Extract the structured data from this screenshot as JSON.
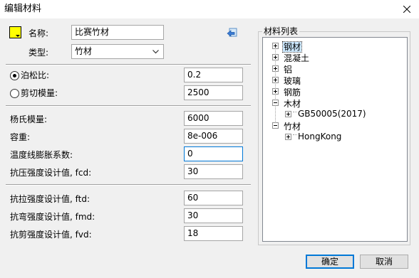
{
  "window": {
    "title": "编辑材料"
  },
  "colors": {
    "swatch": "#ffff00",
    "accent": "#0078d7"
  },
  "header": {
    "name_label": "名称:",
    "name_value": "比赛竹材",
    "type_label": "类型:",
    "type_value": "竹材"
  },
  "elastic": {
    "poisson_label": "泊松比:",
    "poisson_value": "0.2",
    "shear_label": "剪切模量:",
    "shear_value": "2500",
    "selected": "poisson"
  },
  "props": {
    "young_label": "杨氏模量:",
    "young_value": "6000",
    "density_label": "容重:",
    "density_value": "8e-006",
    "thermal_label": "温度线膨胀系数:",
    "thermal_value": "0",
    "fcd_label": "抗压强度设计值, fcd:",
    "fcd_value": "30"
  },
  "strength": {
    "ftd_label": "抗拉强度设计值, ftd:",
    "ftd_value": "60",
    "fmd_label": "抗弯强度设计值, fmd:",
    "fmd_value": "30",
    "fvd_label": "抗剪强度设计值, fvd:",
    "fvd_value": "18"
  },
  "material_list": {
    "title": "材料列表",
    "items": [
      {
        "label": "钢材",
        "state": "collapsed"
      },
      {
        "label": "混凝土",
        "state": "collapsed"
      },
      {
        "label": "铝",
        "state": "collapsed"
      },
      {
        "label": "玻璃",
        "state": "collapsed"
      },
      {
        "label": "钢筋",
        "state": "collapsed"
      },
      {
        "label": "木材",
        "state": "expanded",
        "children": [
          {
            "label": "GB50005(2017)",
            "state": "collapsed"
          }
        ]
      },
      {
        "label": "竹材",
        "state": "expanded",
        "children": [
          {
            "label": "HongKong",
            "state": "collapsed"
          }
        ]
      }
    ]
  },
  "buttons": {
    "ok": "确定",
    "cancel": "取消"
  }
}
